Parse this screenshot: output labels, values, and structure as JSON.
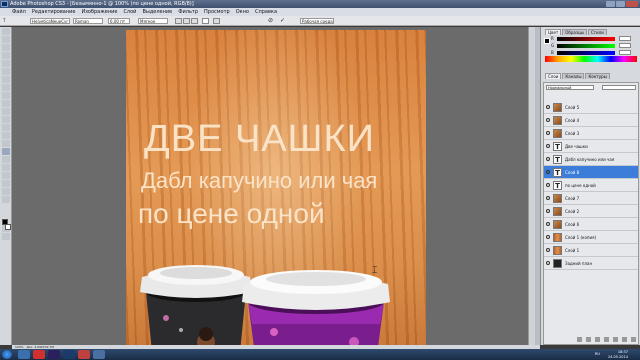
{
  "window": {
    "title": "Adobe Photoshop CS3 - [Безымянно-1 @ 100% (по цене одной, RGB/8)]",
    "logo": "Ps"
  },
  "menu": [
    "Файл",
    "Редактирование",
    "Изображение",
    "Слой",
    "Выделение",
    "Фильтр",
    "Просмотр",
    "Окно",
    "Справка"
  ],
  "options_bar": {
    "font_family": "HelveticaNeueCyr",
    "font_style": "Roman",
    "font_size": "6,00 пт",
    "antialias": "Мягкое",
    "workspace": "Рабочая среда"
  },
  "canvas": {
    "line1": "ДВЕ ЧАШКИ",
    "line2": "Дабл капучино или чая",
    "line3": "по цене одной"
  },
  "color_panel": {
    "tabs": [
      "Цвет",
      "Образцы",
      "Стили"
    ],
    "channels": [
      "R",
      "G",
      "B"
    ]
  },
  "swatch_tabs": [
    "Слои",
    "Каналы",
    "Контуры"
  ],
  "layers_panel": {
    "blend_mode": "Нормальный",
    "layers": [
      {
        "name": "Слой 5",
        "type": "img",
        "selected": false
      },
      {
        "name": "Слой 4",
        "type": "img",
        "selected": false
      },
      {
        "name": "Слой 3",
        "type": "img",
        "selected": false
      },
      {
        "name": "Две чашки",
        "type": "text",
        "selected": false
      },
      {
        "name": "Дабл капучино или чая",
        "type": "text",
        "selected": false
      },
      {
        "name": "Слой 8",
        "type": "text",
        "selected": true
      },
      {
        "name": "по цене одной",
        "type": "text",
        "selected": false
      },
      {
        "name": "Слой 7",
        "type": "img",
        "selected": false
      },
      {
        "name": "Слой 2",
        "type": "img",
        "selected": false
      },
      {
        "name": "Слой 6",
        "type": "img",
        "selected": false
      },
      {
        "name": "Слой 1 (копия)",
        "type": "wood",
        "selected": false
      },
      {
        "name": "Слой 1",
        "type": "wood",
        "selected": false
      },
      {
        "name": "Задний план",
        "type": "dark",
        "selected": false
      }
    ]
  },
  "status": {
    "zoom": "100%",
    "doc_info": "Док: 4,69М/32,7М"
  },
  "taskbar": {
    "lang": "RU",
    "time": "18:37",
    "date": "24.05.2014"
  },
  "colors": {
    "wood_base": "#d77c37",
    "text": "#fbe3c8",
    "selected_layer": "#3b7dd8"
  }
}
